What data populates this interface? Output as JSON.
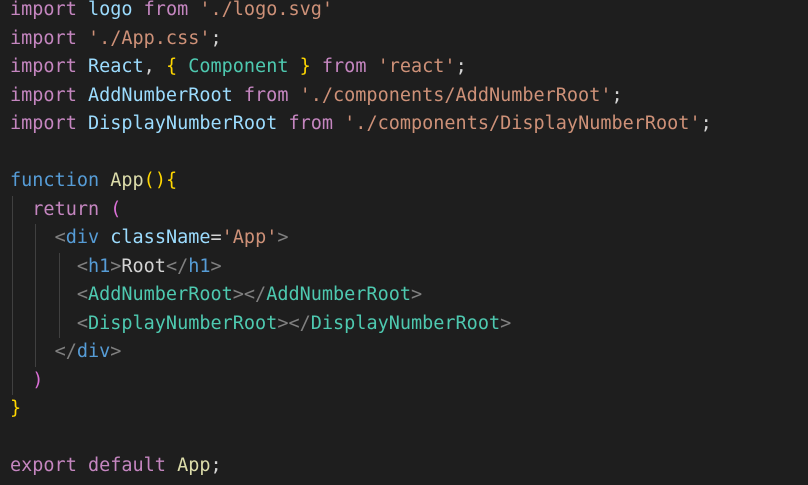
{
  "code": {
    "l1": {
      "kw": "import",
      "id": "logo",
      "from": "from",
      "str": "'./logo.svg'"
    },
    "l2": {
      "kw": "import",
      "str": "'./App.css'",
      "semi": ";"
    },
    "l3": {
      "kw": "import",
      "id": "React",
      "comma": ",",
      "ob": "{",
      "comp": "Component",
      "cb": "}",
      "from": "from",
      "str": "'react'",
      "semi": ";"
    },
    "l4": {
      "kw": "import",
      "id": "AddNumberRoot",
      "from": "from",
      "str": "'./components/AddNumberRoot'",
      "semi": ";"
    },
    "l5": {
      "kw": "import",
      "id": "DisplayNumberRoot",
      "from": "from",
      "str": "'./components/DisplayNumberRoot'",
      "semi": ";"
    },
    "l7": {
      "kw": "function",
      "name": "App",
      "op": "(",
      "cp": ")",
      "ob": "{"
    },
    "l8": {
      "kw": "return",
      "op": "("
    },
    "l9": {
      "lt": "<",
      "tag": "div",
      "attr": "className",
      "eq": "=",
      "str": "'App'",
      "gt": ">"
    },
    "l10": {
      "lt": "<",
      "tag": "h1",
      "gt": ">",
      "text": "Root",
      "lts": "</",
      "tag2": "h1",
      "gt2": ">"
    },
    "l11": {
      "lt": "<",
      "tag": "AddNumberRoot",
      "gt": ">",
      "lts": "</",
      "tag2": "AddNumberRoot",
      "gt2": ">"
    },
    "l12": {
      "lt": "<",
      "tag": "DisplayNumberRoot",
      "gt": ">",
      "lts": "</",
      "tag2": "DisplayNumberRoot",
      "gt2": ">"
    },
    "l13": {
      "lts": "</",
      "tag": "div",
      "gt": ">"
    },
    "l14": {
      "cp": ")"
    },
    "l15": {
      "cb": "}"
    },
    "l17": {
      "kw": "export",
      "kw2": "default",
      "name": "App",
      "semi": ";"
    }
  }
}
